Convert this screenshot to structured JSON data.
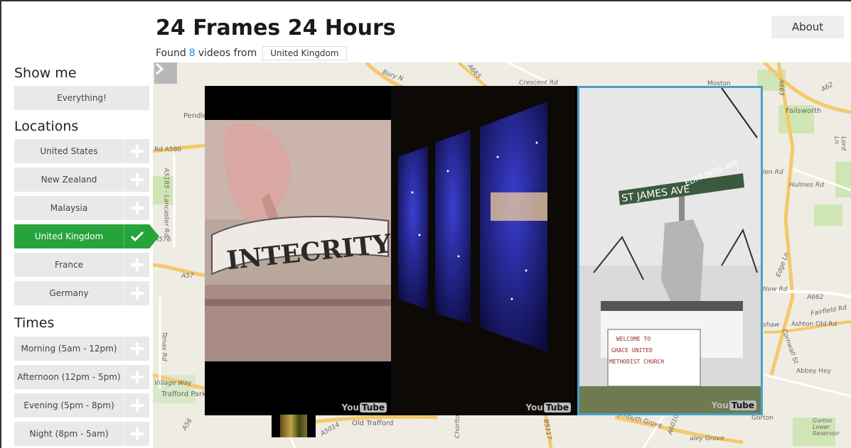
{
  "header": {
    "title": "24 Frames 24 Hours",
    "found_prefix": "Found",
    "found_count": "8",
    "found_suffix": "videos from",
    "filter_chip": "United Kingdom",
    "about_label": "About"
  },
  "sidebar": {
    "show_me_title": "Show me",
    "everything_label": "Everything!",
    "locations_title": "Locations",
    "locations": [
      {
        "label": "United States",
        "selected": false
      },
      {
        "label": "New Zealand",
        "selected": false
      },
      {
        "label": "Malaysia",
        "selected": false
      },
      {
        "label": "United Kingdom",
        "selected": true
      },
      {
        "label": "France",
        "selected": false
      },
      {
        "label": "Germany",
        "selected": false
      }
    ],
    "times_title": "Times",
    "times": [
      {
        "label": "Morning (5am - 12pm)"
      },
      {
        "label": "Afternoon (12pm - 5pm)"
      },
      {
        "label": "Evening (5pm - 8pm)"
      },
      {
        "label": "Night (8pm - 5am)"
      }
    ]
  },
  "map": {
    "labels": {
      "pendlebury": "Pendleb",
      "bury_new": "Bury N",
      "a665": "A665",
      "crescent": "Crescent Rd",
      "moston": "Moston",
      "failsworth": "Failsworth",
      "lord_ln": "Lord Ln",
      "hulmes": "Hulmes Rd",
      "rd_a580": "Rd   A580",
      "a5185": "A5185 - Lancaster Rd",
      "a576": "A576",
      "a57": "A57",
      "village_way": "Village Way",
      "trafford_park": "Trafford Park",
      "old_trafford": "Old Trafford",
      "chorlton": "Chorlton",
      "a5014": "A5014",
      "a56": "A56",
      "plymouth": "Plymouth Grove",
      "ashton_old": "Ashton Old Rd",
      "abbey_hey": "Abbey Hey",
      "new_rd": "New Rd",
      "a662": "A662",
      "fairfield": "Fairfield Rd",
      "gorton": "Gorton Lower Reservoir",
      "edge_ln": "Edge Ln",
      "cornwall": "Cornwall St",
      "len_rd": "len Rd",
      "a663": "A663",
      "a62": "A62",
      "shaw": "shaw",
      "tenax": "Tenax Rd",
      "a6010": "A6010",
      "b5117": "B5117",
      "valley_grove": "aley Grove",
      "gorton_label": "Gorton"
    }
  },
  "videos": {
    "logo_you": "You",
    "logo_tube": "Tube",
    "sign_text": "INTECRITY",
    "street_sign_1": "ST JAMES AVE",
    "street_sign_2": "EDMUNDS AVE",
    "church_line1": "WELCOME TO",
    "church_line2": "GRACE UNITED",
    "church_line3": "METHODIST CHURCH"
  },
  "colors": {
    "accent_green": "#27a33b",
    "link_blue": "#2e7fd1",
    "button_gray": "#e9e9e9",
    "selected_border": "#4aa0c8"
  },
  "icons": {
    "add": "plus-icon",
    "selected": "check-icon",
    "collapse": "chevron-right-icon",
    "brand": "youtube-logo"
  }
}
